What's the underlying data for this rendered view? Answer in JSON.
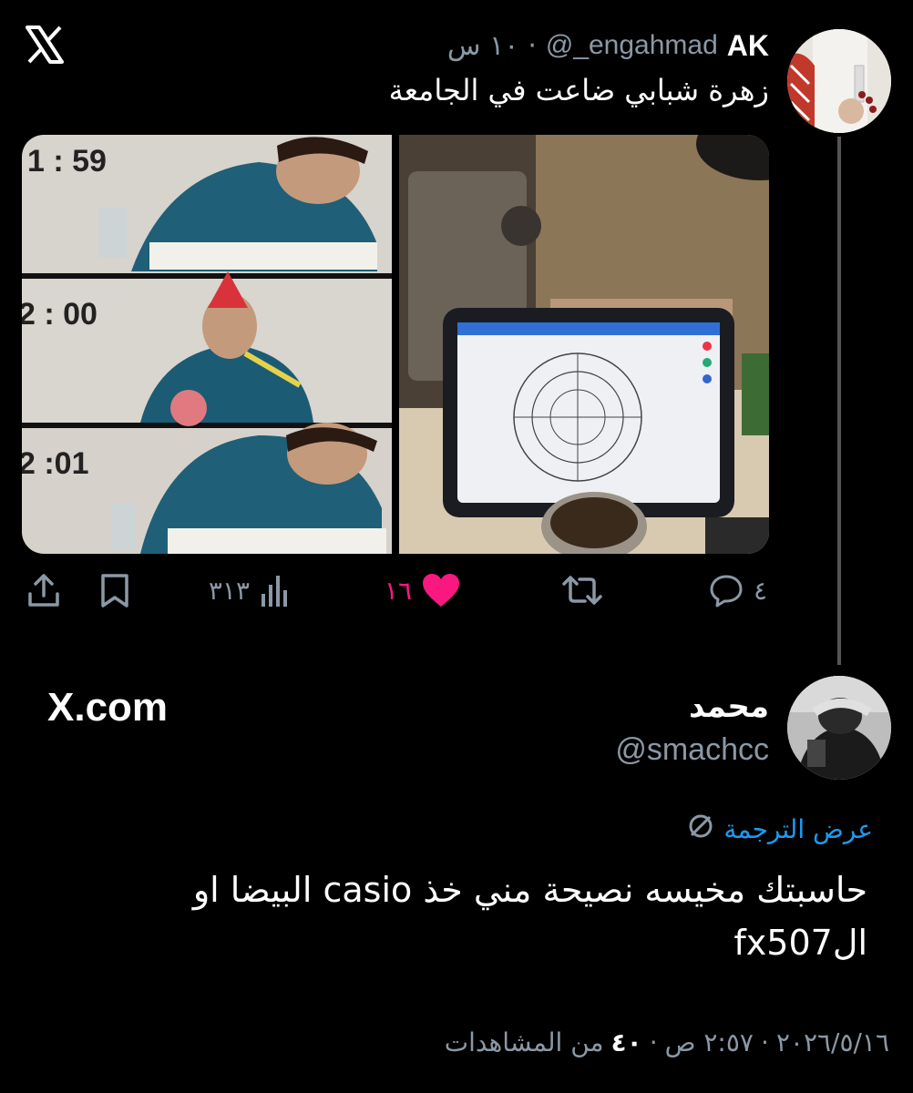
{
  "tweet": {
    "author_name": "AK",
    "author_handle": "@_engahmad",
    "time_ago": "١٠ س",
    "separator": "·",
    "text": "زهرة شبابي ضاعت في الجامعة",
    "media": {
      "panel_times": [
        "1 : 59",
        "2 : 00",
        "2 :01"
      ]
    },
    "actions": {
      "replies": "٤",
      "retweets": "",
      "likes": "١٦",
      "views": "٣١٣"
    },
    "colors": {
      "like": "#f91880",
      "muted": "#8b98a5"
    }
  },
  "reply": {
    "author_name": "محمد",
    "author_handle": "@smachcc",
    "translate_label": "عرض الترجمة",
    "text_line1": "حاسبتك مخيسه نصيحة مني خذ casio البيضا او",
    "text_line2": "الfx507",
    "date": "٢٠٢٦/٥/١٦",
    "time": "٢:٥٧ ص",
    "views_count": "٤٠",
    "views_label": "من المشاهدات",
    "dot": "·"
  },
  "watermark": {
    "text": "X.com"
  },
  "icons": [
    "x-logo-icon",
    "reply-icon",
    "retweet-icon",
    "like-icon",
    "views-icon",
    "bookmark-icon",
    "share-icon",
    "globe-icon"
  ]
}
